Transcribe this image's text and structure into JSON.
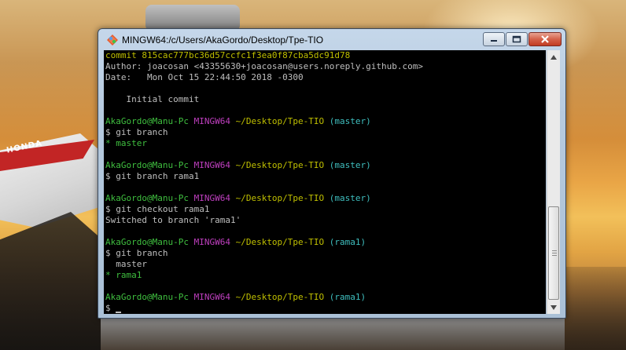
{
  "window": {
    "title": "MINGW64:/c/Users/AkaGordo/Desktop/Tpe-TIO",
    "icon": "git-bash-icon"
  },
  "desktop": {
    "logo_text": "HONDA"
  },
  "colors": {
    "yellow": "#bfbf00",
    "green": "#3fbf3f",
    "magenta": "#bf3fbf",
    "cyan": "#3fbfbf",
    "gray": "#bfbfbf",
    "console_bg": "#000000"
  },
  "terminal": {
    "lines": [
      {
        "segments": [
          {
            "text": "commit 815cac777bc36d57ccfc1f3ea0f87cba5dc91d78",
            "color": "yellow"
          }
        ]
      },
      {
        "segments": [
          {
            "text": "Author: joacosan <43355630+joacosan@users.noreply.github.com>",
            "color": "gray"
          }
        ]
      },
      {
        "segments": [
          {
            "text": "Date:   Mon Oct 15 22:44:50 2018 -0300",
            "color": "gray"
          }
        ]
      },
      {
        "segments": []
      },
      {
        "segments": [
          {
            "text": "    Initial commit",
            "color": "gray"
          }
        ]
      },
      {
        "segments": []
      },
      {
        "segments": [
          {
            "text": "AkaGordo@Manu-Pc ",
            "color": "green"
          },
          {
            "text": "MINGW64 ",
            "color": "magenta"
          },
          {
            "text": "~/Desktop/Tpe-TIO ",
            "color": "yellow"
          },
          {
            "text": "(master)",
            "color": "cyan"
          }
        ]
      },
      {
        "segments": [
          {
            "text": "$ git branch",
            "color": "gray"
          }
        ]
      },
      {
        "segments": [
          {
            "text": "* master",
            "color": "green"
          }
        ]
      },
      {
        "segments": []
      },
      {
        "segments": [
          {
            "text": "AkaGordo@Manu-Pc ",
            "color": "green"
          },
          {
            "text": "MINGW64 ",
            "color": "magenta"
          },
          {
            "text": "~/Desktop/Tpe-TIO ",
            "color": "yellow"
          },
          {
            "text": "(master)",
            "color": "cyan"
          }
        ]
      },
      {
        "segments": [
          {
            "text": "$ git branch rama1",
            "color": "gray"
          }
        ]
      },
      {
        "segments": []
      },
      {
        "segments": [
          {
            "text": "AkaGordo@Manu-Pc ",
            "color": "green"
          },
          {
            "text": "MINGW64 ",
            "color": "magenta"
          },
          {
            "text": "~/Desktop/Tpe-TIO ",
            "color": "yellow"
          },
          {
            "text": "(master)",
            "color": "cyan"
          }
        ]
      },
      {
        "segments": [
          {
            "text": "$ git checkout rama1",
            "color": "gray"
          }
        ]
      },
      {
        "segments": [
          {
            "text": "Switched to branch 'rama1'",
            "color": "gray"
          }
        ]
      },
      {
        "segments": []
      },
      {
        "segments": [
          {
            "text": "AkaGordo@Manu-Pc ",
            "color": "green"
          },
          {
            "text": "MINGW64 ",
            "color": "magenta"
          },
          {
            "text": "~/Desktop/Tpe-TIO ",
            "color": "yellow"
          },
          {
            "text": "(rama1)",
            "color": "cyan"
          }
        ]
      },
      {
        "segments": [
          {
            "text": "$ git branch",
            "color": "gray"
          }
        ]
      },
      {
        "segments": [
          {
            "text": "  master",
            "color": "gray"
          }
        ]
      },
      {
        "segments": [
          {
            "text": "* rama1",
            "color": "green"
          }
        ]
      },
      {
        "segments": []
      },
      {
        "segments": [
          {
            "text": "AkaGordo@Manu-Pc ",
            "color": "green"
          },
          {
            "text": "MINGW64 ",
            "color": "magenta"
          },
          {
            "text": "~/Desktop/Tpe-TIO ",
            "color": "yellow"
          },
          {
            "text": "(rama1)",
            "color": "cyan"
          }
        ]
      },
      {
        "segments": [
          {
            "text": "$ ",
            "color": "gray"
          }
        ],
        "cursor": true
      }
    ]
  }
}
